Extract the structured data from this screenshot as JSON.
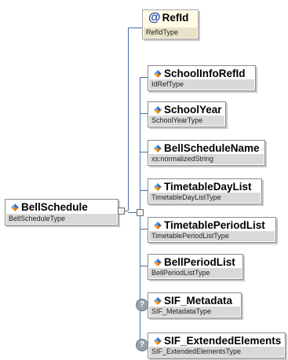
{
  "root": {
    "name": "BellSchedule",
    "type": "BellScheduleType",
    "icon": "element-icon"
  },
  "attribute": {
    "name": "RefId",
    "type": "RefIdType",
    "prefix": "@"
  },
  "children": [
    {
      "name": "SchoolInfoRefId",
      "type": "IdRefType",
      "optional": false
    },
    {
      "name": "SchoolYear",
      "type": "SchoolYearType",
      "optional": false
    },
    {
      "name": "BellScheduleName",
      "type": "xs:normalizedString",
      "optional": false
    },
    {
      "name": "TimetableDayList",
      "type": "TimetableDayListType",
      "optional": false
    },
    {
      "name": "TimetablePeriodList",
      "type": "TimetablePeriodListType",
      "optional": false
    },
    {
      "name": "BellPeriodList",
      "type": "BellPeriodListType",
      "optional": false
    },
    {
      "name": "SIF_Metadata",
      "type": "SIF_MetadataType",
      "optional": true,
      "badge": "?"
    },
    {
      "name": "SIF_ExtendedElements",
      "type": "SIF_ExtendedElementsType",
      "optional": true,
      "badge": "?"
    }
  ],
  "colors": {
    "connector": "#4a6fa5",
    "type_bar": "#d9d9d9",
    "icon_blue": "#2b6cc4",
    "icon_orange": "#f0a030"
  }
}
